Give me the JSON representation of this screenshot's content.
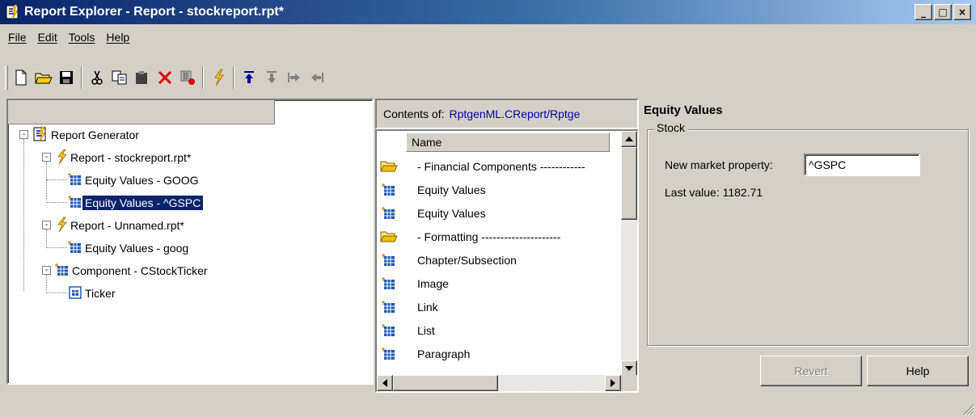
{
  "window": {
    "title": "Report Explorer - Report - stockreport.rpt*",
    "minimize": "_",
    "maximize": "□",
    "close": "×"
  },
  "menu": [
    {
      "label": "File"
    },
    {
      "label": "Edit"
    },
    {
      "label": "Tools"
    },
    {
      "label": "Help"
    }
  ],
  "toolbar": {
    "icons": [
      "new-icon",
      "open-folder-icon",
      "save-icon",
      "cut-icon",
      "copy-icon",
      "paste-icon",
      "delete-icon",
      "disable-component-icon",
      "generate-report-icon",
      "move-up-icon",
      "move-down-icon",
      "demote-icon",
      "promote-icon"
    ]
  },
  "tree": {
    "nodes": [
      {
        "label": "Report Generator",
        "icon": "report-generator-icon"
      },
      {
        "label": "Report - stockreport.rpt*",
        "icon": "lightning-icon"
      },
      {
        "label": "Equity Values - GOOG",
        "icon": "component-icon"
      },
      {
        "label": "Equity Values - ^GSPC",
        "icon": "component-icon",
        "selected": true
      },
      {
        "label": "Report - Unnamed.rpt*",
        "icon": "lightning-icon"
      },
      {
        "label": "Equity Values - goog",
        "icon": "component-icon"
      },
      {
        "label": "Component - CStockTicker",
        "icon": "component-icon"
      },
      {
        "label": "Ticker",
        "icon": "ticker-icon"
      }
    ]
  },
  "contents": {
    "label": "Contents of:",
    "path": "RptgenML.CReport/Rptge",
    "column_header": "Name",
    "items": [
      {
        "label": "- Financial Components ------------",
        "icon": "open-folder-icon"
      },
      {
        "label": "Equity Values",
        "icon": "component-icon"
      },
      {
        "label": "Equity Values",
        "icon": "component-icon"
      },
      {
        "label": "- Formatting ---------------------",
        "icon": "open-folder-icon"
      },
      {
        "label": "Chapter/Subsection",
        "icon": "component-icon"
      },
      {
        "label": "Image",
        "icon": "component-icon"
      },
      {
        "label": "Link",
        "icon": "component-icon"
      },
      {
        "label": "List",
        "icon": "component-icon"
      },
      {
        "label": "Paragraph",
        "icon": "component-icon"
      }
    ]
  },
  "properties": {
    "title": "Equity Values",
    "group": "Stock",
    "field_label": "New market property:",
    "field_value": "^GSPC",
    "last_value": "Last value: 1182.71"
  },
  "buttons": {
    "revert": "Revert",
    "help": "Help"
  }
}
